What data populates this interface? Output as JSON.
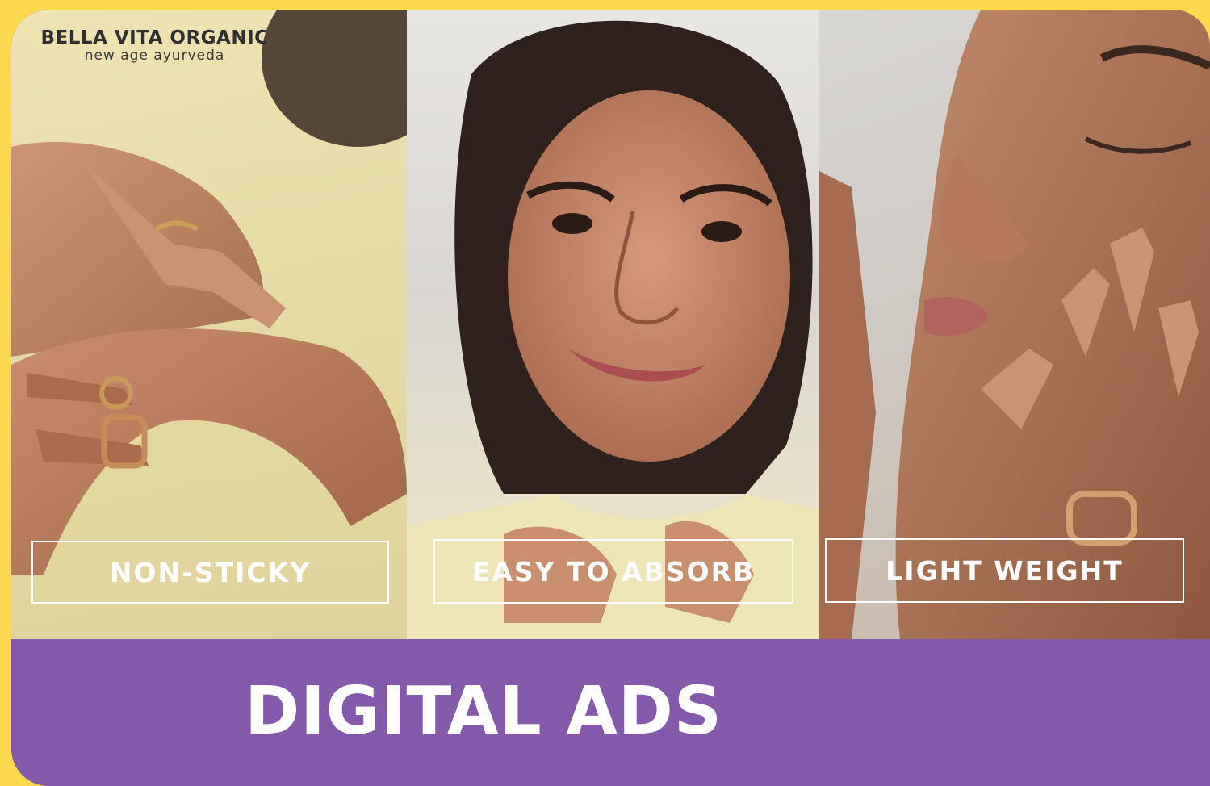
{
  "brand": {
    "name": "BELLA VITA ORGANIC",
    "tagline": "new age ayurveda"
  },
  "panels": [
    {
      "label": "NON-STICKY",
      "scene": "hands applying cream, rings"
    },
    {
      "label": "EASY TO ABSORB",
      "scene": "smiling woman portrait"
    },
    {
      "label": "LIGHT WEIGHT",
      "scene": "face with hands on cheek"
    }
  ],
  "footer": {
    "title": "DIGITAL ADS"
  },
  "colors": {
    "background": "#fbd84c",
    "card": "#8459ab",
    "label_border": "#ffffff",
    "title_text": "#ffffff"
  }
}
